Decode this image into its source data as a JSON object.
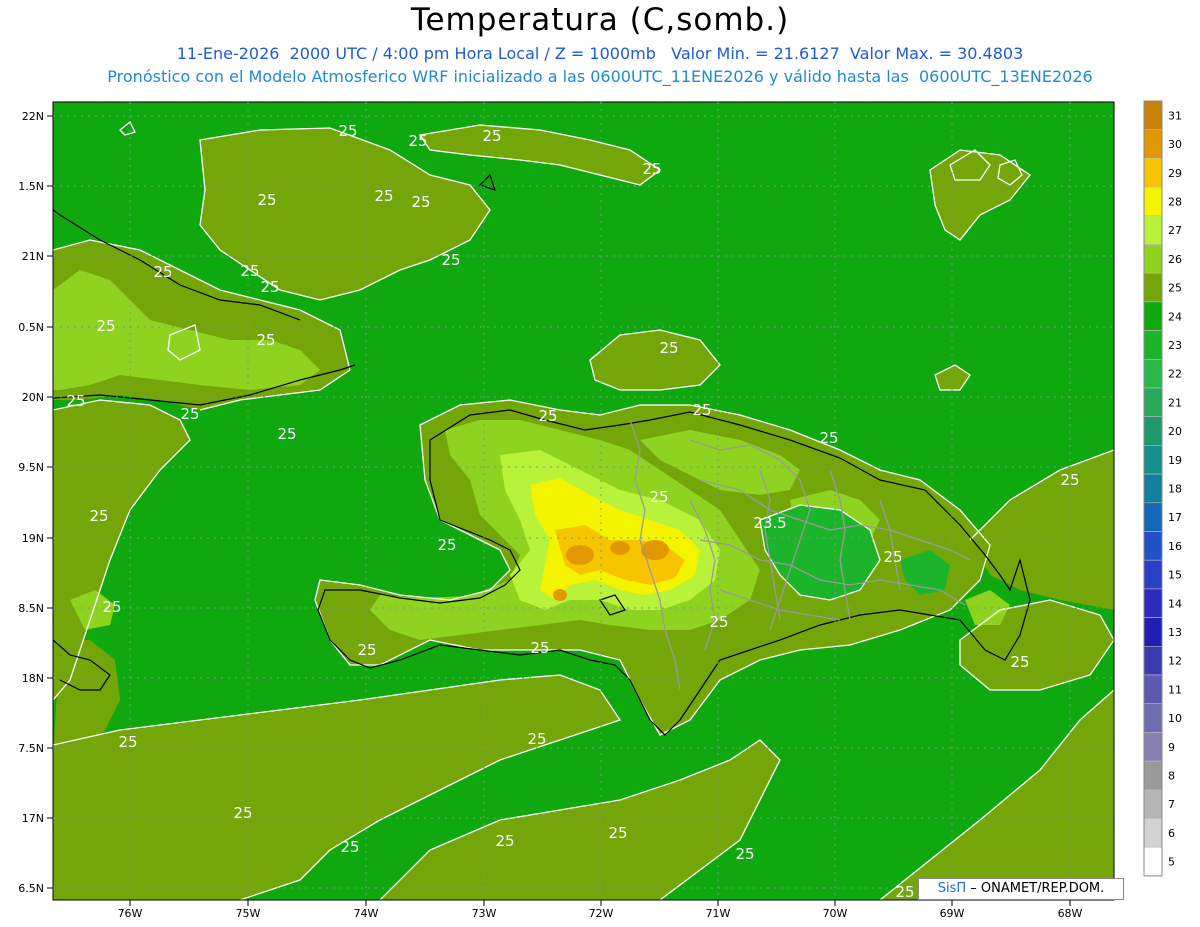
{
  "header": {
    "title": "Temperatura (C,somb.)",
    "line1": "11-Ene-2026  2000 UTC / 4:00 pm Hora Local / Z = 1000mb   Valor Min. = 21.6127  Valor Max. = 30.4803",
    "line2": "Pronóstico con el Modelo Atmosferico WRF inicializado a las 0600UTC_11ENE2026 y válido hasta las  0600UTC_13ENE2026"
  },
  "axes": {
    "lat_labels": [
      "22N",
      "1.5N",
      "21N",
      "0.5N",
      "20N",
      "9.5N",
      "19N",
      "8.5N",
      "18N",
      "7.5N",
      "17N",
      "6.5N"
    ],
    "lon_labels": [
      "76W",
      "75W",
      "74W",
      "73W",
      "72W",
      "71W",
      "70W",
      "69W",
      "68W"
    ]
  },
  "legend": {
    "levels": [
      "31",
      "30",
      "29",
      "28",
      "27",
      "26",
      "25",
      "24",
      "23",
      "22",
      "21",
      "20",
      "19",
      "18",
      "17",
      "16",
      "15",
      "14",
      "13",
      "12",
      "11",
      "10",
      "9",
      "8",
      "7",
      "6",
      "5"
    ],
    "colors": [
      "#c8820a",
      "#e29800",
      "#f7c400",
      "#f4f400",
      "#b9f23a",
      "#8ed31f",
      "#74a60a",
      "#0fa80f",
      "#1bb42a",
      "#2bb84a",
      "#2aa85a",
      "#1f9a6e",
      "#16908a",
      "#137ea0",
      "#1466b8",
      "#1f52c7",
      "#2b3fc6",
      "#2a2abf",
      "#1f1fb3",
      "#3a3ab0",
      "#5a5aae",
      "#6f6fb0",
      "#8a7fb3",
      "#9a9a9a",
      "#b4b4b4",
      "#d2d2d2",
      "#ffffff"
    ]
  },
  "contour_labels": [
    "25",
    "25",
    "25",
    "25",
    "25",
    "25",
    "25",
    "25",
    "25",
    "25",
    "25",
    "25",
    "25",
    "25",
    "25",
    "25",
    "25",
    "25",
    "25",
    "25",
    "25",
    "25",
    "25",
    "25",
    "25",
    "25",
    "25",
    "25",
    "23.5",
    "25"
  ],
  "credit": {
    "brand": "SisΠ",
    "text": "– ONAMET/REP.DOM."
  }
}
